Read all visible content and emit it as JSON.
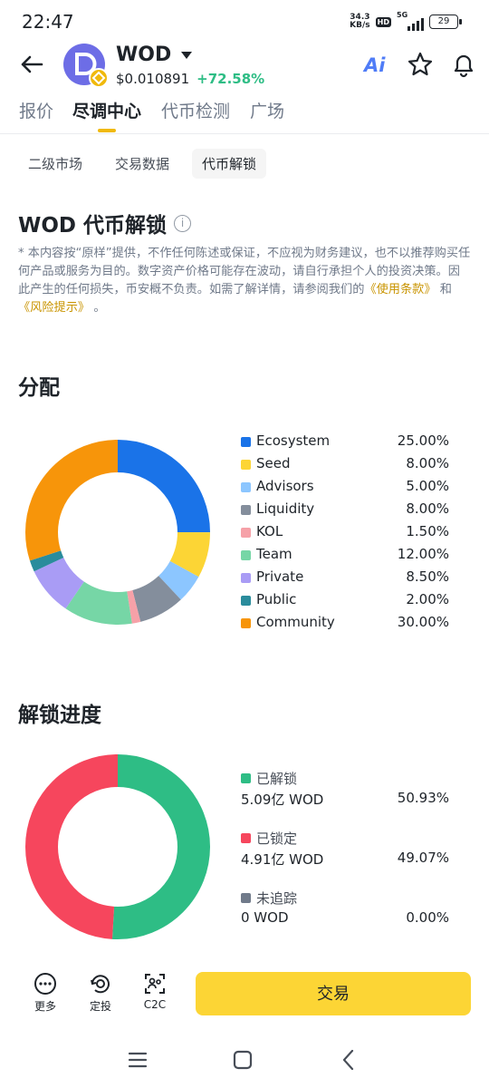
{
  "status": {
    "time": "22:47",
    "net_speed_value": "34.3",
    "net_speed_unit": "KB/s",
    "hd": "HD",
    "network": "5G",
    "battery": "29"
  },
  "header": {
    "token": "WOD",
    "price": "$0.010891",
    "change": "+72.58%",
    "ai_label": "Ai"
  },
  "main_tabs": [
    "报价",
    "尽调中心",
    "代币检测",
    "广场"
  ],
  "sub_tabs": [
    "二级市场",
    "交易数据",
    "代币解锁"
  ],
  "page_title": "WOD 代币解锁",
  "disclaimer": {
    "text": "* 本内容按“原样”提供，不作任何陈述或保证，不应视为财务建议，也不以推荐购买任何产品或服务为目的。数字资产价格可能存在波动，请自行承担个人的投资决策。因此产生的任何损失，币安概不负责。如需了解详情，请参阅我们的",
    "terms": "《使用条款》",
    "and": "和",
    "risk": "《风险提示》",
    "end": "。"
  },
  "allocation": {
    "title": "分配",
    "items": [
      {
        "label": "Ecosystem",
        "pct_text": "25.00%",
        "value": 25.0,
        "color": "#1a73e8"
      },
      {
        "label": "Seed",
        "pct_text": "8.00%",
        "value": 8.0,
        "color": "#fcd535"
      },
      {
        "label": "Advisors",
        "pct_text": "5.00%",
        "value": 5.0,
        "color": "#8cc6ff"
      },
      {
        "label": "Liquidity",
        "pct_text": "8.00%",
        "value": 8.0,
        "color": "#848e9c"
      },
      {
        "label": "KOL",
        "pct_text": "1.50%",
        "value": 1.5,
        "color": "#f6a1a8"
      },
      {
        "label": "Team",
        "pct_text": "12.00%",
        "value": 12.0,
        "color": "#76d6a6"
      },
      {
        "label": "Private",
        "pct_text": "8.50%",
        "value": 8.5,
        "color": "#a99cf5"
      },
      {
        "label": "Public",
        "pct_text": "2.00%",
        "value": 2.0,
        "color": "#2a8c9c"
      },
      {
        "label": "Community",
        "pct_text": "30.00%",
        "value": 30.0,
        "color": "#f7950a"
      }
    ]
  },
  "unlock": {
    "title": "解锁进度",
    "items": [
      {
        "label": "已解锁",
        "amount": "5.09亿 WOD",
        "pct_text": "50.93%",
        "value": 50.93,
        "color": "#2ebd85"
      },
      {
        "label": "已锁定",
        "amount": "4.91亿 WOD",
        "pct_text": "49.07%",
        "value": 49.07,
        "color": "#f6465d"
      },
      {
        "label": "未追踪",
        "amount": "0 WOD",
        "pct_text": "0.00%",
        "value": 0,
        "color": "#707a8a"
      }
    ]
  },
  "actions": {
    "more": "更多",
    "dca": "定投",
    "c2c": "C2C",
    "trade": "交易"
  }
}
